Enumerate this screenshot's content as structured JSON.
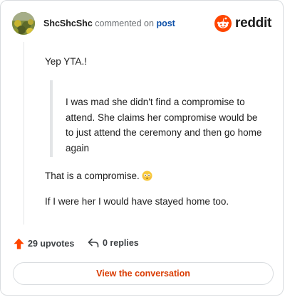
{
  "header": {
    "username": "ShcShcShc",
    "verb": "commented on",
    "post_link": "post",
    "brand": "reddit"
  },
  "comment": {
    "line1": "Yep YTA.!",
    "quote": "I was mad she didn't find a compromise to attend. She claims her compromise would be to just attend the ceremony and then go home again",
    "line2": "That is a compromise.",
    "line3": "If I were her I would have stayed home too."
  },
  "footer": {
    "upvotes": "29 upvotes",
    "replies": "0 replies"
  },
  "cta": {
    "label": "View the conversation"
  },
  "colors": {
    "brand_orange": "#ff4500",
    "link_blue": "#0b4fa8",
    "cta_text": "#d93a00"
  },
  "icons": {
    "avatar": "avatar-image",
    "logo": "reddit-snoo-icon",
    "upvote": "upvote-arrow-icon",
    "reply": "reply-arrow-icon",
    "emoji": "flushed-face-emoji"
  }
}
